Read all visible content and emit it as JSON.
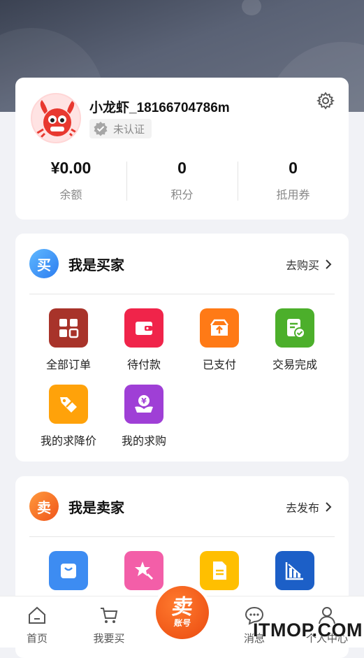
{
  "profile": {
    "username": "小龙虾_18166704786m",
    "verify_status": "未认证",
    "stats": [
      {
        "value": "¥0.00",
        "label": "余额"
      },
      {
        "value": "0",
        "label": "积分"
      },
      {
        "value": "0",
        "label": "抵用券"
      }
    ]
  },
  "buyer": {
    "badge": "买",
    "title": "我是买家",
    "link": "去购买",
    "items": [
      {
        "label": "全部订单",
        "icon": "grid-icon",
        "color": "#a8332a"
      },
      {
        "label": "待付款",
        "icon": "wallet-icon",
        "color": "#f0244a"
      },
      {
        "label": "已支付",
        "icon": "box-upload-icon",
        "color": "#ff7a16"
      },
      {
        "label": "交易完成",
        "icon": "doc-check-icon",
        "color": "#4caf2b"
      },
      {
        "label": "我的求降价",
        "icon": "tag-icon",
        "color": "#ffa20a"
      },
      {
        "label": "我的求购",
        "icon": "coin-hand-icon",
        "color": "#9f3fd6"
      }
    ]
  },
  "seller": {
    "badge": "卖",
    "title": "我是卖家",
    "link": "去发布",
    "items": [
      {
        "icon": "bag-icon",
        "color": "#3d8cf2"
      },
      {
        "icon": "star-search-icon",
        "color": "#f35ea8"
      },
      {
        "icon": "document-icon",
        "color": "#ffbf00"
      },
      {
        "icon": "chart-down-icon",
        "color": "#1c5fc7"
      }
    ]
  },
  "tabbar": {
    "items": [
      {
        "label": "首页",
        "icon": "home-icon"
      },
      {
        "label": "我要买",
        "icon": "cart-icon"
      },
      {
        "label": "消息",
        "icon": "chat-icon"
      },
      {
        "label": "个人中心",
        "icon": "user-icon"
      }
    ],
    "center_big": "卖",
    "center_small": "账号"
  },
  "watermark": "ITMOP.COM"
}
